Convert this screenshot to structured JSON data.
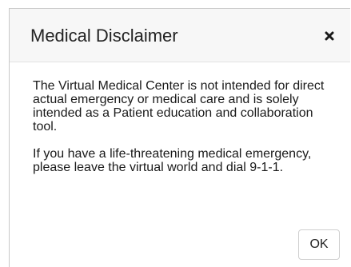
{
  "modal": {
    "title": "Medical Disclaimer",
    "close_icon": "close-icon",
    "paragraphs": [
      "The Virtual Medical Center is not intended for direct actual emergency or medical care and is solely intended as a Patient education and collaboration tool.",
      "If you have a life-threatening medical emergency, please leave the virtual world and dial 9-1-1."
    ],
    "ok_label": "OK"
  },
  "colors": {
    "header_bg": "#f7f7f7",
    "text": "#222222",
    "border": "#c8c8c8"
  }
}
